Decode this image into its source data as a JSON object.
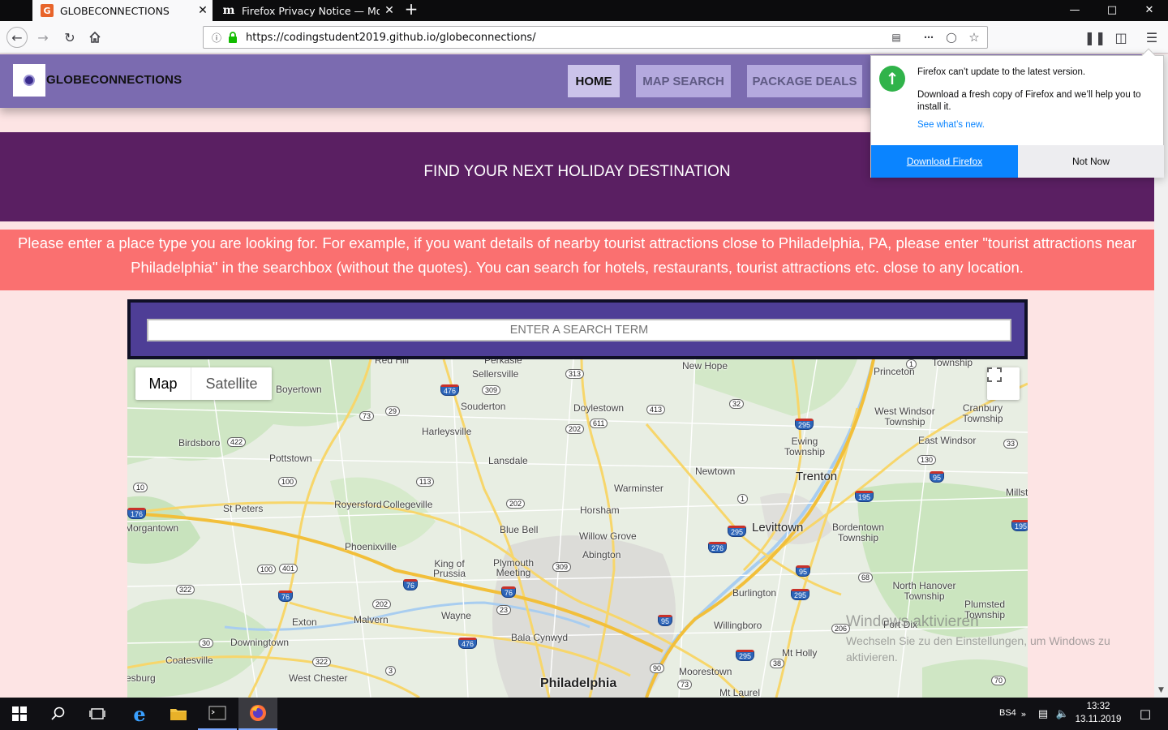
{
  "browser": {
    "tabs": [
      {
        "label": "GLOBECONNECTIONS",
        "favicon": "G",
        "active": true
      },
      {
        "label": "Firefox Privacy Notice — Mozill",
        "favicon": "m",
        "active": false
      }
    ],
    "url": "https://codingstudent2019.github.io/globeconnections/"
  },
  "site": {
    "brand": "GLOBECONNECTIONS",
    "menu": [
      "HOME",
      "MAP SEARCH",
      "PACKAGE DEALS"
    ],
    "hero_title": "FIND YOUR NEXT HOLIDAY DESTINATION",
    "info_text": "Please enter a place type you are looking for. For example, if you want details of nearby tourist attractions close to Philadelphia, PA, please enter \"tourist attractions near Philadelphia\" in the searchbox (without the quotes). You can search for hotels, restaurants, tourist attractions etc. close to any location.",
    "search_placeholder": "ENTER A SEARCH TERM"
  },
  "map": {
    "type_buttons": [
      "Map",
      "Satellite"
    ],
    "places": [
      "Perkasie",
      "Sellersville",
      "New Hope",
      "Princeton",
      "Township",
      "Boyertown",
      "Souderton",
      "Doylestown",
      "West Windsor Township",
      "Cranbury Township",
      "Harleysville",
      "Ewing Township",
      "East Windsor",
      "Birdsboro",
      "Pottstown",
      "Lansdale",
      "Newtown",
      "Trenton",
      "Warminster",
      "Millston",
      "St Peters",
      "Royersford",
      "Collegeville",
      "Horsham",
      "Morgantown",
      "Blue Bell",
      "Levittown",
      "Bordentown Township",
      "Willow Grove",
      "Phoenixville",
      "Abington",
      "King of Prussia",
      "Plymouth Meeting",
      "North Hanover Township",
      "Burlington",
      "Plumsted Township",
      "Wayne",
      "Exton",
      "Malvern",
      "Willingboro",
      "Fort Dix",
      "Bala Cynwyd",
      "Downingtown",
      "Mt Holly",
      "Coatesville",
      "West Chester",
      "Moorestown",
      "Philadelphia",
      "Mt Laurel",
      "Red Hill",
      "esburg"
    ]
  },
  "popup": {
    "heading": "Firefox can’t update to the latest version.",
    "body": "Download a fresh copy of Firefox and we’ll help you to install it.",
    "link": "See what’s new.",
    "primary": "Download Firefox",
    "secondary": "Not Now"
  },
  "watermark": {
    "title": "Windows aktivieren",
    "subtitle": "Wechseln Sie zu den Einstellungen, um Windows zu aktivieren."
  },
  "taskbar": {
    "lang": "BS4",
    "time": "13:32",
    "date": "13.11.2019"
  }
}
